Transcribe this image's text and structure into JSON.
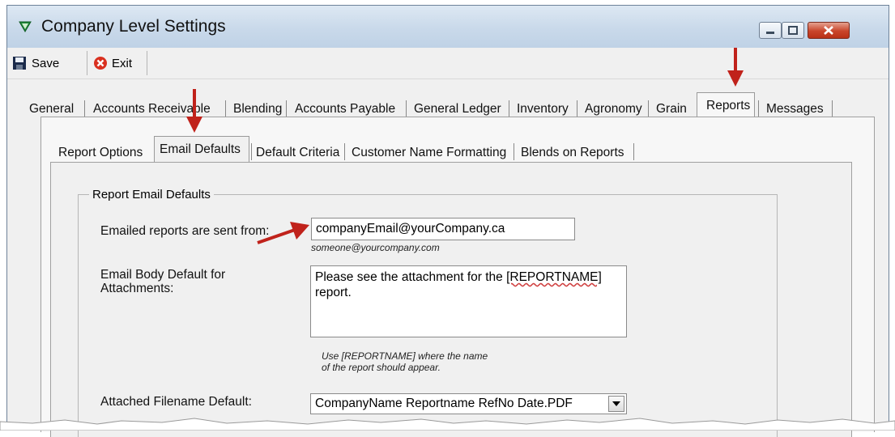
{
  "window": {
    "title": "Company Level Settings"
  },
  "toolbar": {
    "save_label": "Save",
    "exit_label": "Exit"
  },
  "main_tabs": [
    "General",
    "Accounts Receivable",
    "Blending",
    "Accounts Payable",
    "General Ledger",
    "Inventory",
    "Agronomy",
    "Grain",
    "Reports",
    "Messages"
  ],
  "main_tab_selected": "Reports",
  "sub_tabs": [
    "Report Options",
    "Email Defaults",
    "Default Criteria",
    "Customer Name Formatting",
    "Blends on Reports"
  ],
  "sub_tab_selected": "Email Defaults",
  "group": {
    "title": "Report Email Defaults",
    "from_label": "Emailed reports are sent from:",
    "from_value": "companyEmail@yourCompany.ca",
    "from_hint": "someone@yourcompany.com",
    "body_label_line1": "Email Body Default for",
    "body_label_line2": "Attachments:",
    "body_text_before": "Please see the attachment for the ",
    "body_text_token": "[REPORTNAME]",
    "body_text_after": "report.",
    "body_hint_line1": "Use [REPORTNAME] where the name",
    "body_hint_line2": "of the report should appear.",
    "filename_label": "Attached Filename Default:",
    "filename_value": "CompanyName Reportname RefNo Date.PDF"
  },
  "colors": {
    "arrow": "#c0221b",
    "titlebar": "#c9d9ea",
    "close_button": "#c9452a"
  },
  "icons": [
    "app-triangle-icon",
    "minimize-icon",
    "maximize-icon",
    "close-icon",
    "save-disk-icon",
    "exit-x-icon",
    "chevron-down-icon"
  ]
}
